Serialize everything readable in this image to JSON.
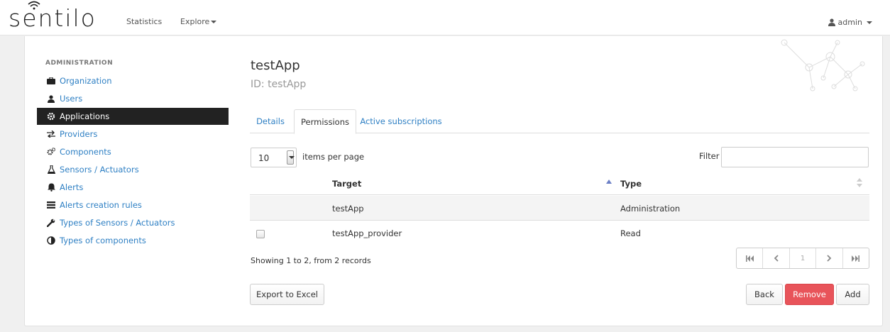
{
  "navbar": {
    "logo_text": "sentilo",
    "statistics": "Statistics",
    "explore": "Explore",
    "user": "admin"
  },
  "sidebar": {
    "header": "ADMINISTRATION",
    "items": [
      {
        "label": "Organization",
        "icon": "briefcase-icon"
      },
      {
        "label": "Users",
        "icon": "user-icon"
      },
      {
        "label": "Applications",
        "icon": "gear-icon",
        "active": true
      },
      {
        "label": "Providers",
        "icon": "exchange-icon"
      },
      {
        "label": "Components",
        "icon": "cogs-icon"
      },
      {
        "label": "Sensors / Actuators",
        "icon": "flask-icon"
      },
      {
        "label": "Alerts",
        "icon": "bell-icon"
      },
      {
        "label": "Alerts creation rules",
        "icon": "list-icon"
      },
      {
        "label": "Types of Sensors / Actuators",
        "icon": "wrench-icon"
      },
      {
        "label": "Types of components",
        "icon": "contrast-icon"
      }
    ]
  },
  "main": {
    "title": "testApp",
    "id_line": "ID: testApp",
    "tabs": [
      {
        "label": "Details"
      },
      {
        "label": "Permissions",
        "active": true
      },
      {
        "label": "Active subscriptions"
      }
    ],
    "per_page_value": "10",
    "per_page_label": "items per page",
    "filter_label": "Filter",
    "filter_value": "",
    "table": {
      "columns": [
        "Target",
        "Type"
      ],
      "rows": [
        {
          "target": "testApp",
          "type": "Administration",
          "checkbox": false
        },
        {
          "target": "testApp_provider",
          "type": "Read",
          "checkbox": true
        }
      ]
    },
    "showing": "Showing 1 to 2, from 2 records",
    "pager": {
      "first": "⏮",
      "prev": "‹",
      "page": "1",
      "next": "›",
      "last": "⏭"
    },
    "buttons": {
      "export": "Export to Excel",
      "back": "Back",
      "remove": "Remove",
      "add": "Add"
    }
  },
  "colors": {
    "link": "#2f80c4",
    "active_bg": "#222222",
    "remove": "#e8545a"
  }
}
